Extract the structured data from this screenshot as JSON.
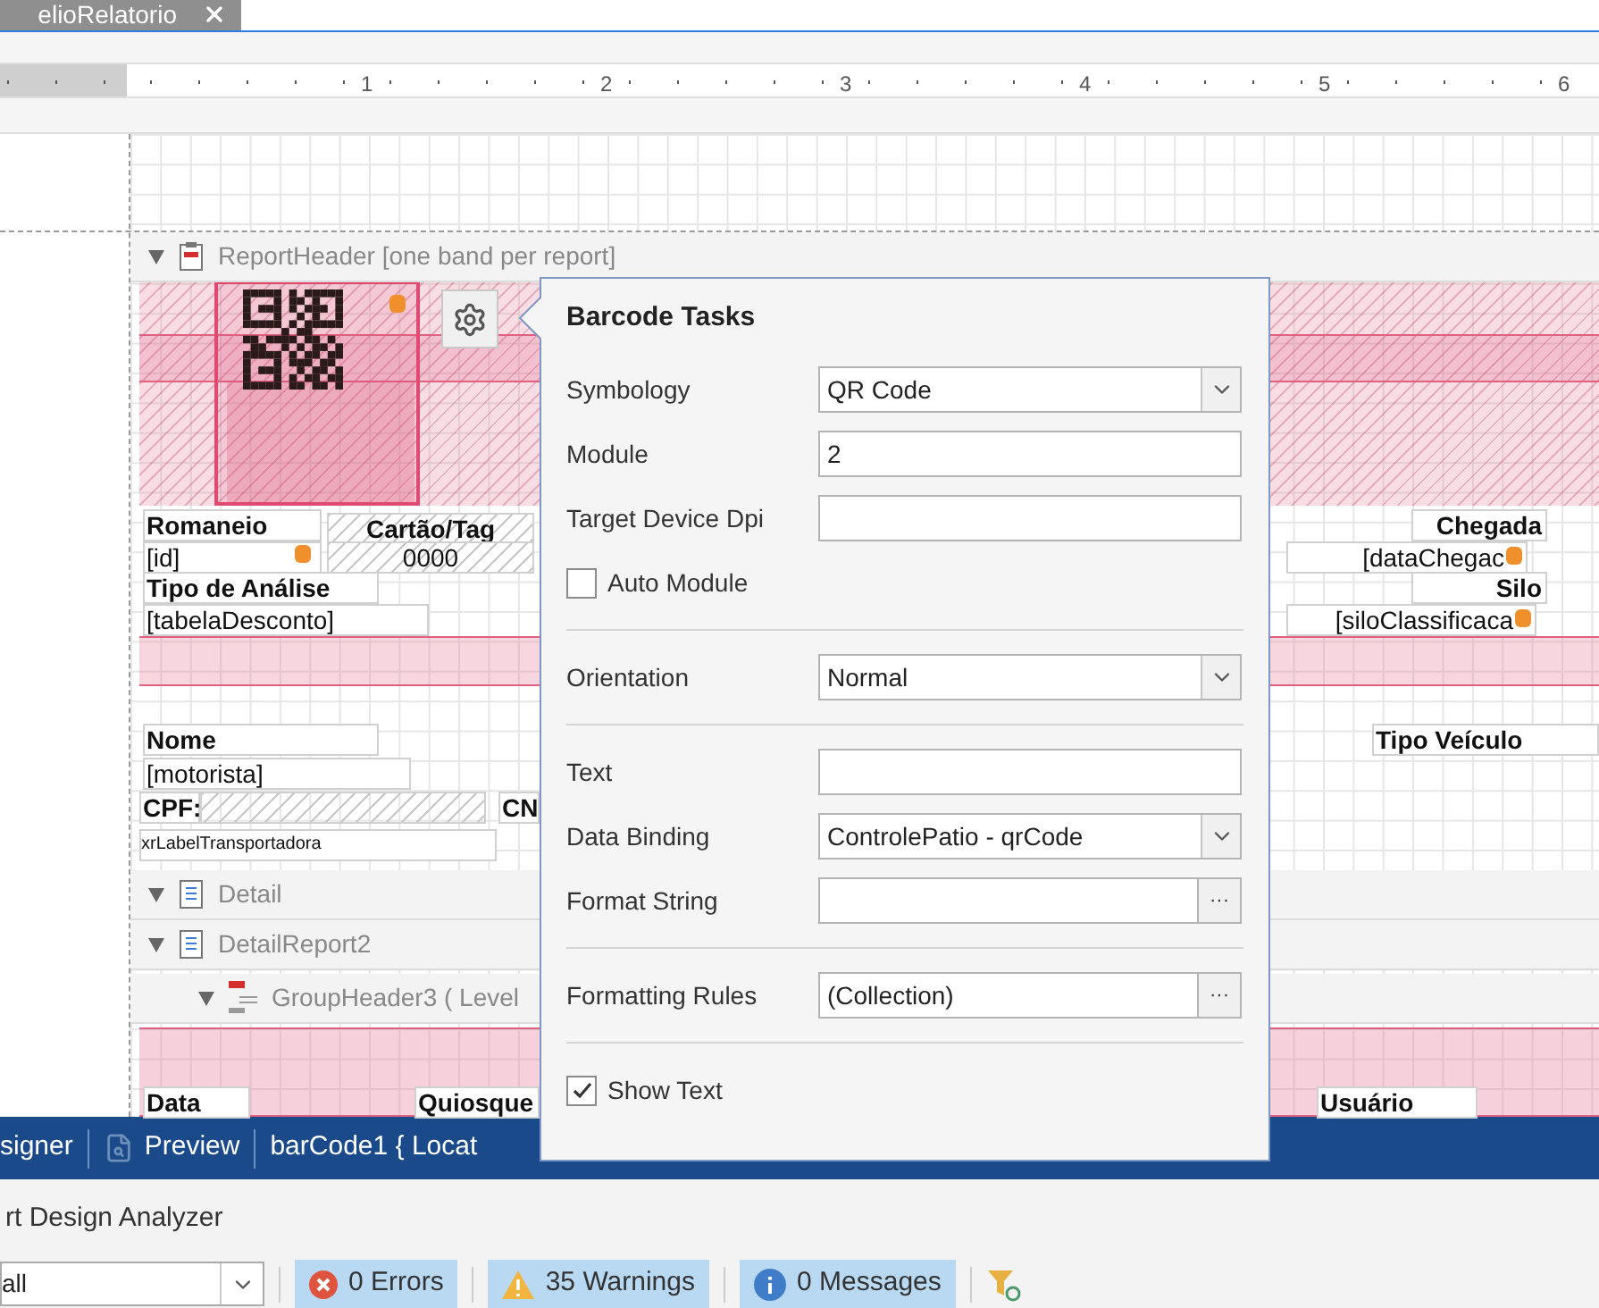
{
  "document_tab": {
    "label": "elioRelatorio",
    "selected": true
  },
  "ruler": {
    "labels": [
      "1",
      "2",
      "3",
      "4",
      "5",
      "6"
    ]
  },
  "bands": [
    {
      "kind": "report-header",
      "label": "ReportHeader [one band per report]",
      "expanded": true
    },
    {
      "kind": "detail",
      "label": "Detail",
      "expanded": true
    },
    {
      "kind": "detail-report",
      "label": "DetailReport2",
      "expanded": true
    },
    {
      "kind": "group-header",
      "label": "GroupHeader3 ( Level",
      "expanded": true
    }
  ],
  "report_controls": [
    {
      "kind": "caption",
      "text": "Romaneio"
    },
    {
      "kind": "caption-hatched",
      "text": "Cartão/Tag"
    },
    {
      "kind": "field",
      "text": "[id]"
    },
    {
      "kind": "value-hatched",
      "text": "0000"
    },
    {
      "kind": "caption",
      "text": "Tipo de Análise"
    },
    {
      "kind": "field",
      "text": "[tabelaDesconto]"
    },
    {
      "kind": "caption",
      "text": "Nome"
    },
    {
      "kind": "field",
      "text": "[motorista]"
    },
    {
      "kind": "caption",
      "text": "CPF:"
    },
    {
      "kind": "caption",
      "text": "CN"
    },
    {
      "kind": "small",
      "text": "xrLabelTransportadora"
    },
    {
      "kind": "caption-right",
      "text": "Chegada"
    },
    {
      "kind": "field-right",
      "text": "[dataChegac"
    },
    {
      "kind": "caption-right",
      "text": "Silo"
    },
    {
      "kind": "field-right",
      "text": "[siloClassificaca"
    },
    {
      "kind": "caption",
      "text": "Tipo Veículo"
    },
    {
      "kind": "caption",
      "text": "Data"
    },
    {
      "kind": "caption",
      "text": "Quiosque"
    },
    {
      "kind": "caption",
      "text": "Usuário"
    }
  ],
  "barcode_tasks": {
    "title": "Barcode Tasks",
    "groups": [
      [
        {
          "kind": "select",
          "label": "Symbology",
          "value": "QR Code"
        },
        {
          "kind": "input",
          "label": "Module",
          "value": "2"
        },
        {
          "kind": "input",
          "label": "Target Device Dpi"
        },
        {
          "kind": "checkbox",
          "label": "Auto Module",
          "checked": false
        }
      ],
      [
        {
          "kind": "select",
          "label": "Orientation",
          "value": "Normal"
        }
      ],
      [
        {
          "kind": "input",
          "label": "Text"
        },
        {
          "kind": "select",
          "label": "Data Binding",
          "value": "ControlePatio - qrCode"
        },
        {
          "kind": "ellipsis",
          "label": "Format String",
          "button": "···"
        }
      ],
      [
        {
          "kind": "ellipsis",
          "label": "Formatting Rules",
          "value": "(Collection)",
          "button": "···"
        }
      ],
      [
        {
          "kind": "checkbox",
          "label": "Show Text",
          "checked": true
        }
      ]
    ]
  },
  "view_tabs": [
    {
      "kind": "designer",
      "label": "signer"
    },
    {
      "kind": "preview",
      "label": "Preview"
    },
    {
      "kind": "status",
      "label": "barCode1 { Locat"
    }
  ],
  "analyzer": {
    "title": "rt Design Analyzer",
    "filter": "all",
    "counters": [
      {
        "kind": "error",
        "label": "0 Errors",
        "selected": true
      },
      {
        "kind": "warning",
        "label": "35 Warnings",
        "selected": true
      },
      {
        "kind": "info",
        "label": "0 Messages",
        "selected": true
      }
    ]
  }
}
